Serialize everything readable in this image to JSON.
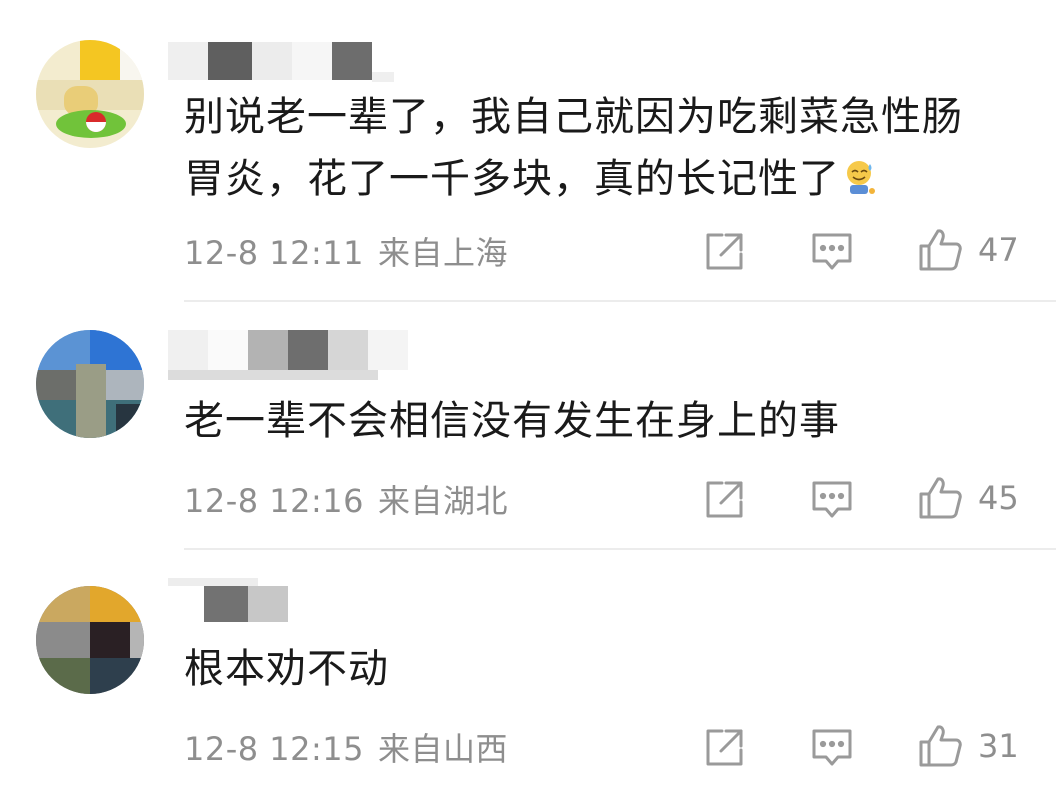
{
  "comments": [
    {
      "text_line1": "别说老一辈了，我自己就因为吃剩菜急性肠",
      "text_line2": "胃炎，花了一千多块，真的长记性了",
      "emoji_icon": "sweat-smile-emoji-icon",
      "time": "12-8 12:11",
      "location": "来自上海",
      "likes": "47"
    },
    {
      "text": "老一辈不会相信没有发生在身上的事",
      "time": "12-8 12:16",
      "location": "来自湖北",
      "likes": "45"
    },
    {
      "text": "根本劝不动",
      "time": "12-8 12:15",
      "location": "来自山西",
      "likes": "31"
    }
  ],
  "actions": {
    "share_icon": "share-icon",
    "reply_icon": "reply-icon",
    "like_icon": "thumbs-up-icon"
  },
  "colors": {
    "text": "#1a1a1a",
    "meta": "#8e8e8e",
    "icon": "#9a9a9a",
    "divider": "#ececec"
  }
}
